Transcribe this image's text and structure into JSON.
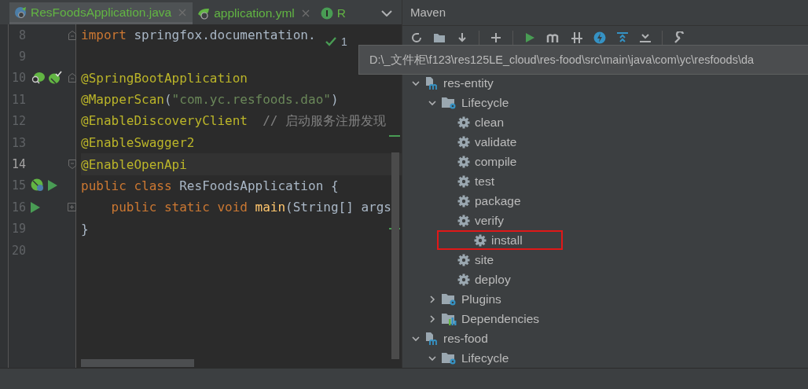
{
  "editor": {
    "tabs": [
      {
        "label": "ResFoodsApplication.java",
        "kind": "spring-class",
        "selected": true,
        "closable": true
      },
      {
        "label": "application.yml",
        "kind": "spring-config",
        "selected": false,
        "closable": true
      },
      {
        "label": "R",
        "kind": "interface",
        "selected": false,
        "closable": false
      }
    ],
    "inspection_count": "1",
    "lines": [
      {
        "number": "8",
        "current": false,
        "fold": {
          "kind": "start"
        },
        "indented": false,
        "tokens": [
          {
            "kind": "keyword",
            "text": "import "
          },
          {
            "kind": "plain",
            "text": "springfox.documentation."
          }
        ]
      },
      {
        "number": "9",
        "current": false
      },
      {
        "number": "10",
        "current": false,
        "fold": {
          "kind": "start"
        },
        "gutter": [
          {
            "kind": "bean-search"
          },
          {
            "kind": "bean-check"
          }
        ],
        "indented": false,
        "tokens": [
          {
            "kind": "annotation",
            "text": "@SpringBootApplication"
          }
        ]
      },
      {
        "number": "11",
        "current": false,
        "indented": false,
        "tokens": [
          {
            "kind": "annotation",
            "text": "@MapperScan"
          },
          {
            "kind": "plain",
            "text": "("
          },
          {
            "kind": "string",
            "text": "\"com.yc.resfoods.dao\""
          },
          {
            "kind": "plain",
            "text": ")"
          }
        ]
      },
      {
        "number": "12",
        "current": false,
        "indented": false,
        "tokens": [
          {
            "kind": "annotation",
            "text": "@EnableDiscoveryClient"
          },
          {
            "kind": "comment",
            "text": "// 启动服务注册发现"
          }
        ]
      },
      {
        "number": "13",
        "current": false,
        "indented": false,
        "tokens": [
          {
            "kind": "annotation",
            "text": "@EnableSwagger2"
          }
        ]
      },
      {
        "number": "14",
        "current": true,
        "fold": {
          "kind": "end"
        },
        "indented": false,
        "tokens": [
          {
            "kind": "annotation",
            "text": "@EnableOpenApi"
          }
        ]
      },
      {
        "number": "15",
        "current": false,
        "gutter": [
          {
            "kind": "spring-bean"
          },
          {
            "kind": "run"
          }
        ],
        "indented": false,
        "tokens": [
          {
            "kind": "keyword",
            "text": "public class "
          },
          {
            "kind": "plain",
            "text": "ResFoodsApplication {"
          }
        ]
      },
      {
        "number": "16",
        "current": false,
        "fold": {
          "kind": "collapsed"
        },
        "gutter": [
          {
            "kind": "run"
          }
        ],
        "indented": true,
        "tokens": [
          {
            "kind": "keyword",
            "text": "public static void "
          },
          {
            "kind": "method",
            "text": "main"
          },
          {
            "kind": "plain",
            "text": "(String[] args"
          }
        ]
      },
      {
        "number": "19",
        "current": false,
        "indented": false,
        "tokens": [
          {
            "kind": "plain",
            "text": "}"
          }
        ]
      },
      {
        "number": "20",
        "current": false
      }
    ]
  },
  "maven": {
    "title": "Maven",
    "tooltip": "D:\\_文件柜\\f123\\res125LE_cloud\\res-food\\src\\main\\java\\com\\yc\\resfoods\\da",
    "tree": [
      {
        "label": "res-entity",
        "kind": "module",
        "expanded": true,
        "children": [
          {
            "label": "Lifecycle",
            "kind": "lifecycle",
            "expanded": true,
            "children": [
              {
                "label": "clean",
                "kind": "goal",
                "highlighted": false
              },
              {
                "label": "validate",
                "kind": "goal",
                "highlighted": false
              },
              {
                "label": "compile",
                "kind": "goal",
                "highlighted": false
              },
              {
                "label": "test",
                "kind": "goal",
                "highlighted": false
              },
              {
                "label": "package",
                "kind": "goal",
                "highlighted": false
              },
              {
                "label": "verify",
                "kind": "goal",
                "highlighted": false
              },
              {
                "label": "install",
                "kind": "goal",
                "highlighted": true
              },
              {
                "label": "site",
                "kind": "goal",
                "highlighted": false
              },
              {
                "label": "deploy",
                "kind": "goal",
                "highlighted": false
              }
            ]
          },
          {
            "label": "Plugins",
            "kind": "plugins",
            "expanded": false
          },
          {
            "label": "Dependencies",
            "kind": "dependencies",
            "expanded": false
          }
        ]
      },
      {
        "label": "res-food",
        "kind": "module",
        "expanded": true,
        "children": [
          {
            "label": "Lifecycle",
            "kind": "lifecycle",
            "expanded": true
          }
        ]
      }
    ]
  }
}
